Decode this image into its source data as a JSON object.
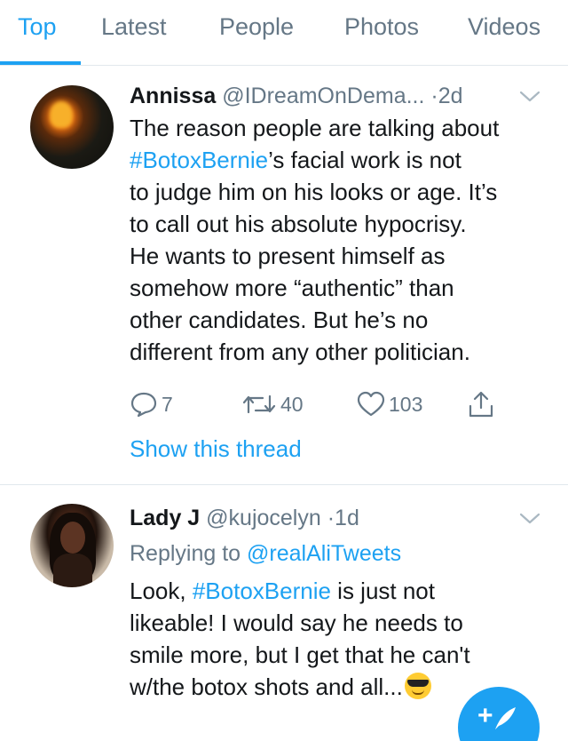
{
  "tabs": [
    {
      "label": "Top",
      "active": true
    },
    {
      "label": "Latest",
      "active": false
    },
    {
      "label": "People",
      "active": false
    },
    {
      "label": "Photos",
      "active": false
    },
    {
      "label": "Videos",
      "active": false
    }
  ],
  "tweets": [
    {
      "name": "Annissa",
      "handle": "@IDreamOnDema...",
      "separator": "·",
      "time": "2d",
      "text_lines": [
        {
          "plain_before": "The reason people are talking about",
          "hashtag": "",
          "plain_after": ""
        },
        {
          "plain_before": "",
          "hashtag": "#BotoxBernie",
          "plain_after": "’s facial work is not"
        },
        {
          "plain_before": "to judge him on his looks or age. It’s",
          "hashtag": "",
          "plain_after": ""
        },
        {
          "plain_before": "to call out his absolute hypocrisy.",
          "hashtag": "",
          "plain_after": ""
        },
        {
          "plain_before": "He wants to present himself as",
          "hashtag": "",
          "plain_after": ""
        },
        {
          "plain_before": "somehow more “authentic” than",
          "hashtag": "",
          "plain_after": ""
        },
        {
          "plain_before": "other candidates. But he’s no",
          "hashtag": "",
          "plain_after": ""
        },
        {
          "plain_before": "different from any other politician.",
          "hashtag": "",
          "plain_after": ""
        }
      ],
      "replies": "7",
      "retweets": "40",
      "likes": "103",
      "thread_link": "Show this thread"
    },
    {
      "name": "Lady J",
      "handle": "@kujocelyn",
      "separator": "·",
      "time": "1d",
      "replying_prefix": "Replying to ",
      "replying_to": "@realAliTweets",
      "text_lines": [
        {
          "plain_before": "Look, ",
          "hashtag": "#BotoxBernie",
          "plain_after": " is just not"
        },
        {
          "plain_before": "likeable! I would say he needs to",
          "hashtag": "",
          "plain_after": ""
        },
        {
          "plain_before": "smile more, but I get that he can't",
          "hashtag": "",
          "plain_after": ""
        },
        {
          "plain_before": "w/the botox shots and all...",
          "hashtag": "",
          "plain_after": ""
        }
      ],
      "emoji": "smiling-face-with-sunglasses"
    }
  ],
  "compose": {
    "icon": "compose-tweet-icon",
    "plus": "+"
  },
  "colors": {
    "accent": "#1da1f2",
    "muted": "#657786",
    "text": "#14171a",
    "divider": "#e1e8ed"
  }
}
